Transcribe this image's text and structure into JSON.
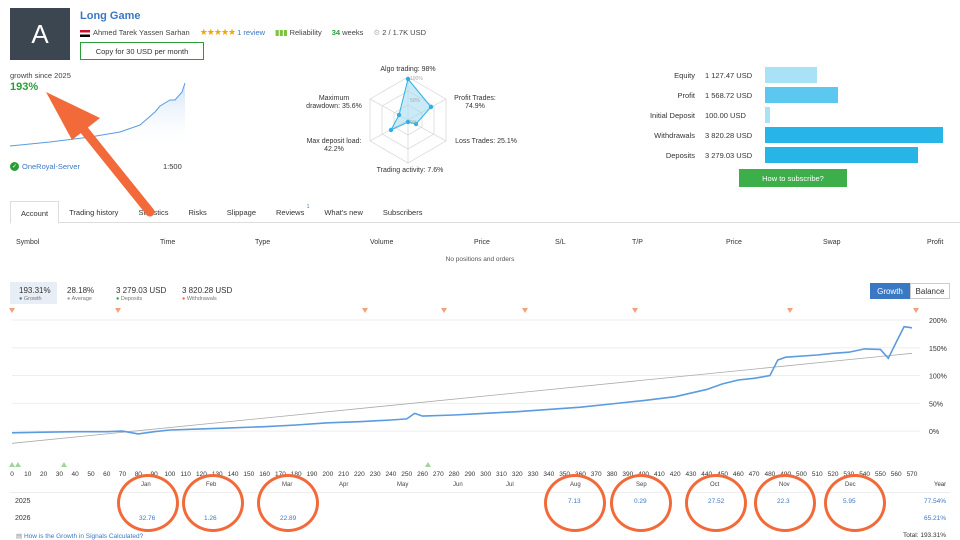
{
  "header": {
    "avatar_letter": "A",
    "title": "Long Game",
    "author": "Ahmed Tarek Yassen Sarhan",
    "stars": "★★★★★",
    "reviews": "1 review",
    "reliability": "Reliability",
    "weeks_num": "34",
    "weeks_label": "weeks",
    "subscribers": "2 / 1.7K USD",
    "copy_button": "Copy for 30 USD per month"
  },
  "summary": {
    "growth_label": "growth since 2025",
    "growth_value": "193%",
    "server": "OneRoyal-Server",
    "leverage": "1:500"
  },
  "radar": {
    "algo": "Algo trading: 98%",
    "profit": "Profit Trades:\n74.9%",
    "loss": "Loss Trades: 25.1%",
    "activity": "Trading activity: 7.6%",
    "deposit_load": "Max deposit load:\n42.2%",
    "drawdown": "Maximum\ndrawdown: 35.6%",
    "scale_100": "100%",
    "scale_50": "50%",
    "scale_0": "0%"
  },
  "right_table": {
    "rows": [
      {
        "label": "Equity",
        "value": "1 127.47 USD",
        "bar_fraction": 0.29,
        "color": "#a9e2f7"
      },
      {
        "label": "Profit",
        "value": "1 568.72 USD",
        "bar_fraction": 0.41,
        "color": "#5cc8ef"
      },
      {
        "label": "Initial Deposit",
        "value": "100.00 USD",
        "bar_fraction": 0.03,
        "color": "#a9e2f7"
      },
      {
        "label": "Withdrawals",
        "value": "3 820.28 USD",
        "bar_fraction": 1.0,
        "color": "#27b5e8"
      },
      {
        "label": "Deposits",
        "value": "3 279.03 USD",
        "bar_fraction": 0.86,
        "color": "#27b5e8"
      }
    ],
    "subscribe_button": "How to subscribe?"
  },
  "tabs": [
    {
      "label": "Account",
      "active": true
    },
    {
      "label": "Trading history"
    },
    {
      "label": "Statistics"
    },
    {
      "label": "Risks"
    },
    {
      "label": "Slippage"
    },
    {
      "label": "Reviews",
      "sup": "1"
    },
    {
      "label": "What's new"
    },
    {
      "label": "Subscribers"
    }
  ],
  "positions_table": {
    "columns": [
      "Symbol",
      "Time",
      "Type",
      "Volume",
      "Price",
      "S/L",
      "T/P",
      "Price",
      "Swap",
      "Profit"
    ],
    "empty_text": "No positions and orders"
  },
  "growth_stats": {
    "growth": {
      "value": "193.31%",
      "label": "Growth"
    },
    "average": {
      "value": "28.18%",
      "label": "Average"
    },
    "deposits": {
      "value": "3 279.03 USD",
      "label": "Deposits"
    },
    "withdrawals": {
      "value": "3 820.28 USD",
      "label": "Withdrawals"
    },
    "btn_growth": "Growth",
    "btn_balance": "Balance"
  },
  "chart_data": {
    "type": "line",
    "x_ticks": [
      0,
      10,
      20,
      30,
      40,
      50,
      60,
      70,
      80,
      90,
      100,
      110,
      120,
      130,
      140,
      150,
      160,
      170,
      180,
      190,
      200,
      210,
      220,
      230,
      240,
      250,
      260,
      270,
      280,
      290,
      300,
      310,
      320,
      330,
      340,
      350,
      360,
      370,
      380,
      390,
      400,
      410,
      420,
      430,
      440,
      450,
      460,
      470,
      480,
      490,
      500,
      510,
      520,
      530,
      540,
      550,
      560,
      570
    ],
    "y_ticks": [
      "200%",
      "150%",
      "100%",
      "50%",
      "0%"
    ],
    "ylim": [
      -25,
      200
    ],
    "xlim": [
      0,
      570
    ],
    "series": [
      {
        "values_x": [
          0,
          20,
          40,
          60,
          70,
          80,
          90,
          100,
          120,
          140,
          160,
          180,
          200,
          220,
          240,
          250,
          255,
          260,
          280,
          300,
          320,
          340,
          360,
          380,
          400,
          420,
          440,
          450,
          460,
          470,
          480,
          485,
          490,
          510,
          520,
          530,
          540,
          550,
          555,
          560,
          565,
          570
        ],
        "values_y": [
          -3,
          -2,
          -1,
          -1,
          0,
          -5,
          -1,
          2,
          4,
          6,
          8,
          11,
          15,
          17,
          20,
          22,
          32,
          27,
          29,
          32,
          35,
          39,
          43,
          49,
          55,
          62,
          75,
          85,
          92,
          95,
          100,
          128,
          133,
          137,
          140,
          142,
          148,
          147,
          131,
          160,
          188,
          186
        ]
      },
      {
        "values_x": [
          0,
          570
        ],
        "values_y": [
          -22,
          140
        ]
      }
    ]
  },
  "months_table": {
    "months": [
      "Jan",
      "Feb",
      "Mar",
      "Apr",
      "May",
      "Jun",
      "Jul",
      "Aug",
      "Sep",
      "Oct",
      "Nov",
      "Dec"
    ],
    "year_header": "Year",
    "rows": [
      {
        "year": "2025",
        "values": [
          "",
          "",
          "",
          "",
          "",
          "",
          "",
          "7.13",
          "0.29",
          "27.52",
          "22.3",
          "5.95"
        ],
        "total": "77.54%"
      },
      {
        "year": "2026",
        "values": [
          "32.76",
          "1.26",
          "22.89",
          "",
          "",
          "",
          "",
          "",
          "",
          "",
          "",
          ""
        ],
        "total": "65.21%"
      }
    ],
    "footer_link": "How is the Growth in Signals Calculated?",
    "footer_total": "Total: 193.31%"
  },
  "colors": {
    "accent_blue": "#3a78c4",
    "accent_green": "#2a9d3a",
    "annotation_orange": "#f26a3a"
  }
}
